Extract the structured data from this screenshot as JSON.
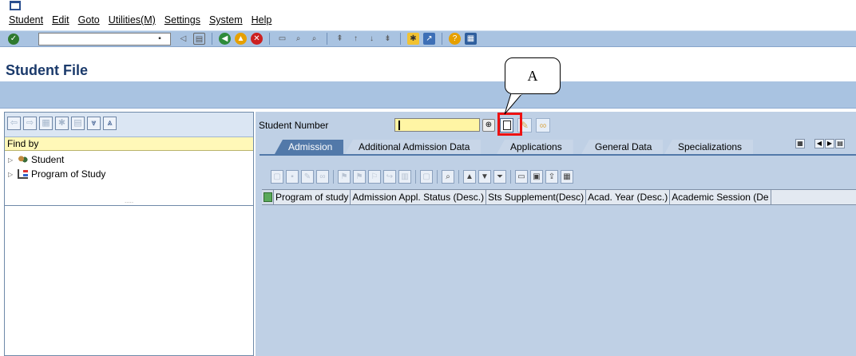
{
  "menu": {
    "items": [
      "Student",
      "Edit",
      "Goto",
      "Utilities(M)",
      "Settings",
      "System",
      "Help"
    ]
  },
  "toolbar": {
    "command_field_value": "",
    "icons": [
      "enter-icon",
      "save-icon",
      "back-icon",
      "exit-icon",
      "cancel-icon",
      "print-icon",
      "find-icon",
      "find-next-icon",
      "first-page-icon",
      "previous-page-icon",
      "next-page-icon",
      "last-page-icon",
      "new-session-icon",
      "shortcut-icon",
      "help-icon",
      "layout-icon"
    ]
  },
  "app": {
    "title": "Student File"
  },
  "left_pane": {
    "header": "Find by",
    "tree": [
      "Student",
      "Program of Study"
    ],
    "resizer_dots": "....."
  },
  "right_pane": {
    "student_number_label": "Student Number",
    "student_number_value": "",
    "tabs": [
      "Admission",
      "Additional Admission Data",
      "Applications",
      "General Data",
      "Specializations"
    ],
    "active_tab": "Admission",
    "grid_columns": [
      "Program of study",
      "Admission Appl. Status (Desc.)",
      "Sts Supplement(Desc)",
      "Acad. Year (Desc.)",
      "Academic Session (De"
    ]
  },
  "annotation": {
    "label": "A",
    "highlight_color": "#ee1111"
  },
  "colors": {
    "toolbar_bg": "#a9c3e1",
    "title_text": "#1b3a6b",
    "active_tab": "#5279a9",
    "input_bg": "#fff5a4"
  }
}
